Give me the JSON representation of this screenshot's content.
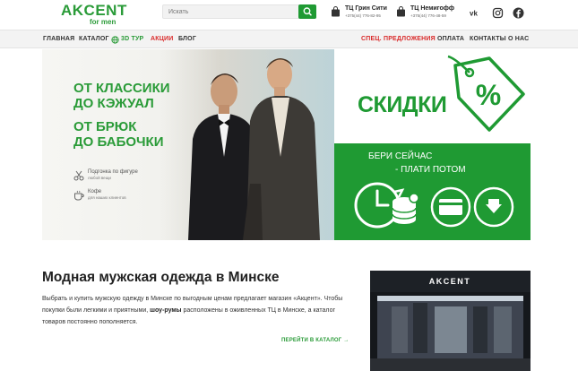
{
  "header": {
    "logo_main": "AKCENT",
    "logo_sub": "for men",
    "search_placeholder": "Искать",
    "stores": [
      {
        "name": "ТЦ Грин Сити",
        "phone": "+375(44) 776-82-95"
      },
      {
        "name": "ТЦ Немигофф",
        "phone": "+375(44) 776-48-59"
      }
    ],
    "social": [
      "vk-icon",
      "instagram-icon",
      "facebook-icon"
    ]
  },
  "nav": {
    "left": [
      "ГЛАВНАЯ",
      "КАТАЛОГ",
      "3D ТУР",
      "АКЦИИ",
      "БЛОГ"
    ],
    "right": [
      "СПЕЦ. ПРЕДЛОЖЕНИЯ",
      "ОПЛАТА",
      "КОНТАКТЫ",
      "О НАС"
    ]
  },
  "banner": {
    "slogans": [
      "ОТ КЛАССИКИ",
      "ДО КЭЖУАЛ",
      "ОТ БРЮК",
      "ДО БАБОЧКИ"
    ],
    "perks": [
      {
        "line1": "Подгонка по фигуре",
        "line2": "любой вещи"
      },
      {
        "line1": "Кофе",
        "line2": "для наших клиентов"
      }
    ],
    "sale_word": "СКИДКИ",
    "take_now": "БЕРИ СЕЙЧАС",
    "pay_later": "- ПЛАТИ ПОТОМ",
    "storefront_sign": "AKCENT"
  },
  "about": {
    "title": "Модная мужская одежда в Минске",
    "text_part1": "Выбрать и купить мужскую одежду в Минске по выгодным ценам предлагает магазин «Акцент». Чтобы покупки были легкими и приятными,",
    "text_bold": "шоу-румы",
    "text_part2": "расположены в оживленных ТЦ в Минске, а каталог товаров постоянно пополняется.",
    "catalog_link": "ПЕРЕЙТИ В КАТАЛОГ →"
  },
  "colors": {
    "brand_green": "#2a9b38",
    "accent_red": "#d92b2b"
  }
}
